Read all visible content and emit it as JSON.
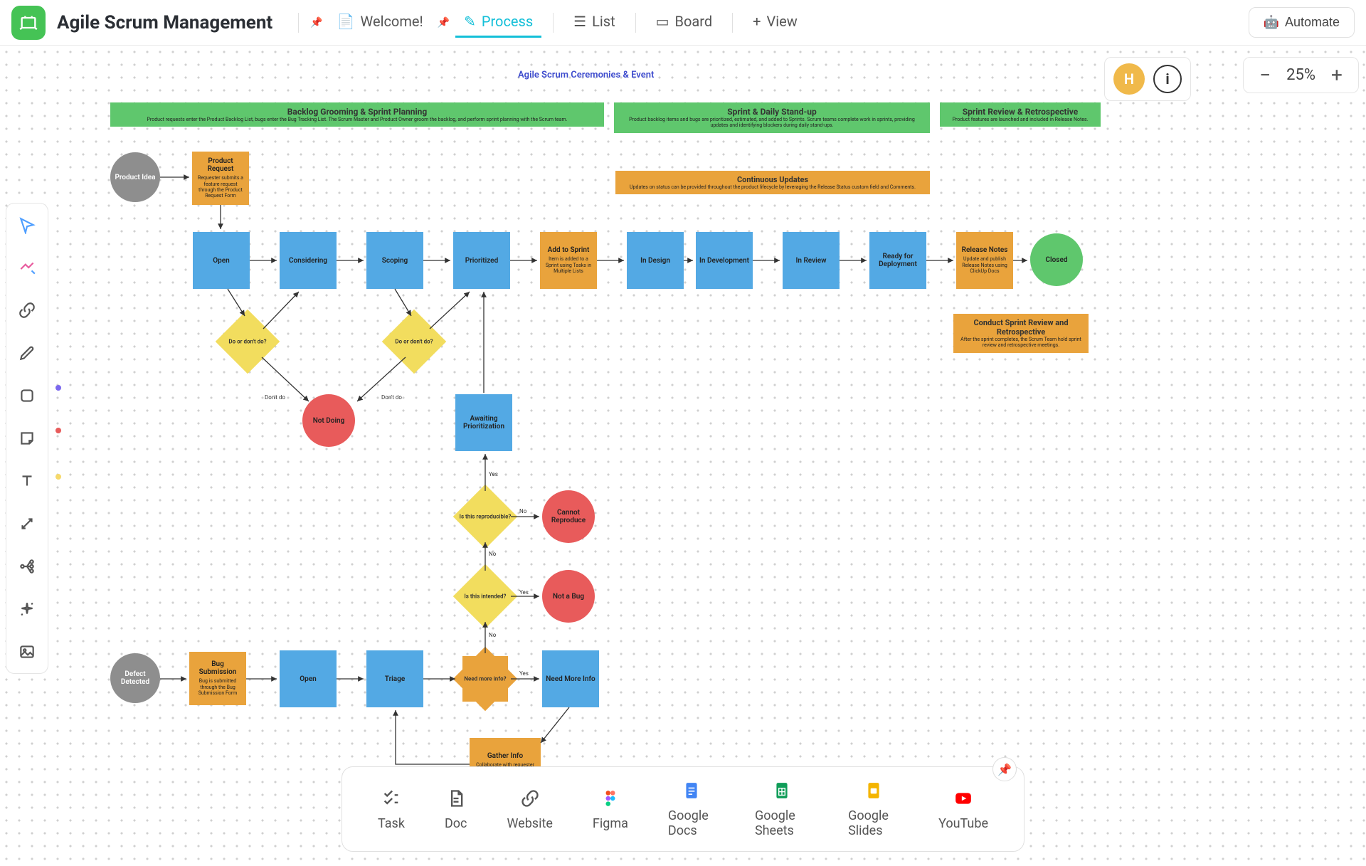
{
  "appTitle": "Agile Scrum Management",
  "tabs": {
    "welcome": "Welcome!",
    "process": "Process",
    "list": "List",
    "board": "Board",
    "add": "View"
  },
  "automate": "Automate",
  "avatar": "H",
  "zoom": "25%",
  "diagram": {
    "title": "Agile Scrum Ceremonies & Event",
    "headers": {
      "planning": {
        "t": "Backlog Grooming & Sprint Planning",
        "st": "Product requests enter the Product Backlog List, bugs enter the Bug Tracking List.\nThe Scrum Master and Product Owner groom the backlog, and perform sprint planning with the Scrum team."
      },
      "standup": {
        "t": "Sprint & Daily Stand-up",
        "st": "Product backlog items and bugs are prioritized, estimated, and added to Sprints. Scrum teams complete work in sprints, providing updates and identifying blockers during daily stand-ups."
      },
      "review": {
        "t": "Sprint Review & Retrospective",
        "st": "Product features are launched and included in Release Notes."
      }
    },
    "subheaders": {
      "updates": {
        "t": "Continuous Updates",
        "st": "Updates on status can be provided throughout the product lifecycle by leveraging the Release Status custom field and Comments."
      },
      "retro": {
        "t": "Conduct Sprint Review and Retrospective",
        "st": "After the sprint completes, the Scrum Team hold sprint review and retrospective meetings."
      }
    },
    "labels": {
      "productIdea": "Product Idea",
      "productRequest": "Product Request",
      "productRequestSub": "Requester submits a feature request through the Product Request Form",
      "open": "Open",
      "considering": "Considering",
      "scoping": "Scoping",
      "prioritized": "Prioritized",
      "addSprint": "Add to Sprint",
      "addSprintSub": "Item is added to a Sprint using Tasks in Multiple Lists",
      "inDesign": "In Design",
      "inDev": "In Development",
      "inReview": "In Review",
      "readyDeploy": "Ready for Deployment",
      "releaseNotes": "Release Notes",
      "releaseNotesSub": "Update and publish Release Notes using ClickUp Docs",
      "closed": "Closed",
      "doDont1": "Do or don't do?",
      "doDont2": "Do or don't do?",
      "notDoing": "Not Doing",
      "awaiting": "Awaiting Prioritization",
      "reproducible": "Is this reproducible?",
      "intended": "Is this intended?",
      "cannotRepro": "Cannot Reproduce",
      "notBug": "Not a Bug",
      "defect": "Defect Detected",
      "bugSub": "Bug Submission",
      "bugSubSub": "Bug is submitted through the Bug Submission Form",
      "open2": "Open",
      "triage": "Triage",
      "moreInfo": "Need more info?",
      "needMoreInfo": "Need More Info",
      "gatherInfo": "Gather Info",
      "gatherInfoSub": "Collaborate with requester using comments and @mentions",
      "yes": "Yes",
      "no": "No",
      "dontDo": "Don't do"
    }
  },
  "dock": {
    "task": "Task",
    "doc": "Doc",
    "website": "Website",
    "figma": "Figma",
    "gdocs": "Google Docs",
    "gsheets": "Google Sheets",
    "gslides": "Google Slides",
    "youtube": "YouTube"
  }
}
